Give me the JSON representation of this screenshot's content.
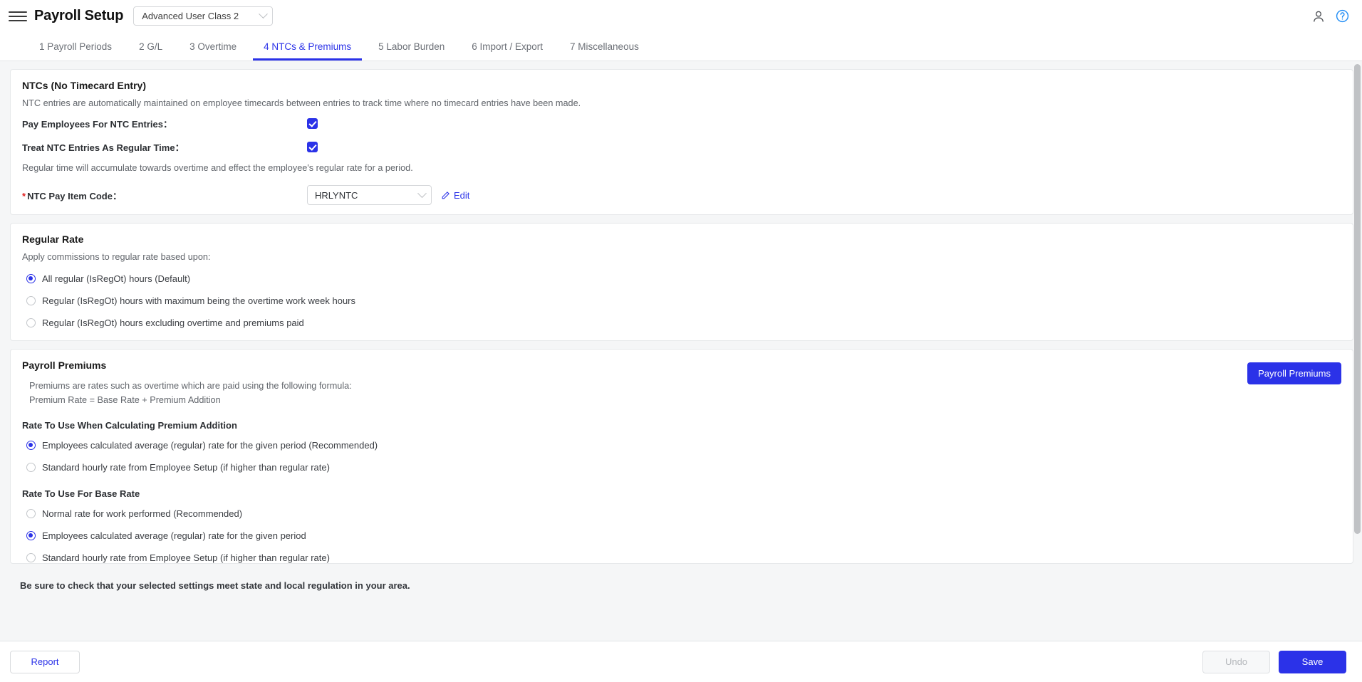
{
  "header": {
    "menu_icon": "hamburger-icon",
    "title": "Payroll Setup",
    "user_class_value": "Advanced User Class 2",
    "user_icon": "user-icon",
    "help_icon": "help-circle-icon"
  },
  "tabs": [
    {
      "label": "1 Payroll Periods",
      "active": false
    },
    {
      "label": "2 G/L",
      "active": false
    },
    {
      "label": "3 Overtime",
      "active": false
    },
    {
      "label": "4 NTCs & Premiums",
      "active": true
    },
    {
      "label": "5 Labor Burden",
      "active": false
    },
    {
      "label": "6 Import / Export",
      "active": false
    },
    {
      "label": "7 Miscellaneous",
      "active": false
    }
  ],
  "ntc_panel": {
    "title": "NTCs (No Timecard Entry)",
    "description": "NTC entries are automatically maintained on employee timecards between entries to track time where no timecard entries have been made.",
    "pay_employees_label": "Pay Employees For NTC Entries：",
    "pay_employees_checked": true,
    "treat_as_regular_label": "Treat NTC Entries As Regular Time：",
    "treat_as_regular_checked": true,
    "regular_time_note": "Regular time will accumulate towards overtime and effect the employee's regular rate for a period.",
    "pay_item_required": "*",
    "pay_item_label": "NTC Pay Item Code：",
    "pay_item_value": "HRLYNTC",
    "edit_label": "Edit"
  },
  "regular_rate_panel": {
    "title": "Regular Rate",
    "description": "Apply commissions to regular rate based upon:",
    "options": [
      {
        "label": "All regular (IsRegOt) hours (Default)",
        "selected": true
      },
      {
        "label": "Regular (IsRegOt) hours with maximum being the overtime work week hours",
        "selected": false
      },
      {
        "label": "Regular (IsRegOt) hours excluding overtime and premiums paid",
        "selected": false
      }
    ]
  },
  "premiums_panel": {
    "title": "Payroll Premiums",
    "formula_line1": "Premiums are rates such as overtime which are paid using the following formula:",
    "formula_line2": "Premium Rate = Base Rate + Premium Addition",
    "premiums_button": "Payroll Premiums",
    "addition_title": "Rate To Use When Calculating Premium Addition",
    "addition_options": [
      {
        "label": "Employees calculated average (regular) rate for the given period (Recommended)",
        "selected": true
      },
      {
        "label": "Standard hourly rate from Employee Setup (if higher than regular rate)",
        "selected": false
      }
    ],
    "base_title": "Rate To Use For Base Rate",
    "base_options": [
      {
        "label": "Normal rate for work performed (Recommended)",
        "selected": false
      },
      {
        "label": "Employees calculated average (regular) rate for the given period",
        "selected": true
      },
      {
        "label": "Standard hourly rate from Employee Setup (if higher than regular rate)",
        "selected": false
      }
    ]
  },
  "note": "Be sure to check that your selected settings meet state and local regulation in your area.",
  "footer": {
    "report_label": "Report",
    "undo_label": "Undo",
    "save_label": "Save"
  },
  "colors": {
    "accent": "#2b32e8",
    "required": "#e02020",
    "page_bg": "#f5f6f7"
  }
}
